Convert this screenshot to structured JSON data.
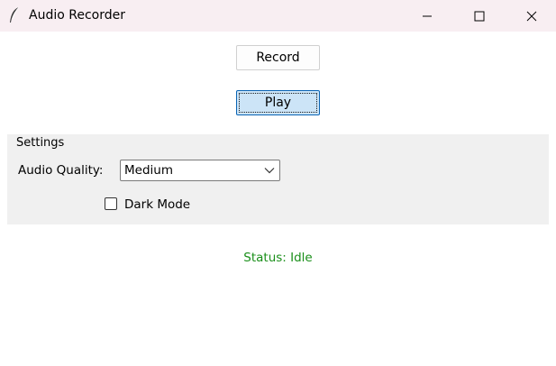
{
  "window": {
    "title": "Audio Recorder",
    "app_icon": "feather-icon",
    "controls": [
      "minimize-icon",
      "maximize-icon",
      "close-icon"
    ]
  },
  "buttons": {
    "record_label": "Record",
    "play_label": "Play"
  },
  "settings": {
    "title": "Settings",
    "quality_label": "Audio Quality:",
    "quality_value": "Medium",
    "dark_mode_label": "Dark Mode",
    "dark_mode_checked": false
  },
  "status": {
    "text": "Status: Idle",
    "color": "#1a8f1a"
  },
  "colors": {
    "titlebar_bg": "#f8eef2",
    "settings_bg": "#f0f0f0",
    "focused_button_bg": "#cce4f7",
    "focused_button_border": "#0a64b4"
  }
}
